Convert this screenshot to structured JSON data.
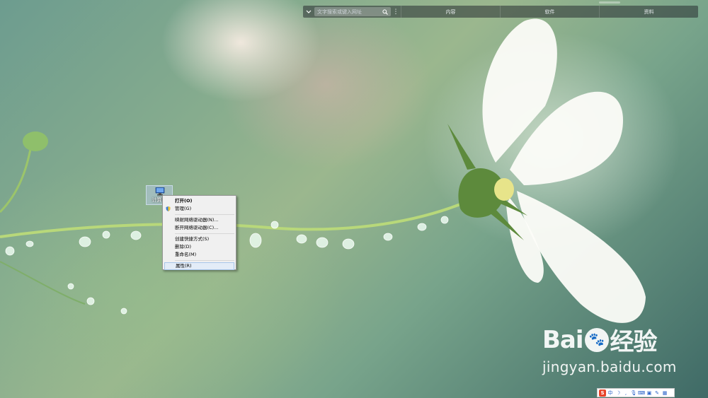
{
  "toolbar": {
    "search_placeholder": "文字搜索或键入网址",
    "tabs": [
      "内容",
      "软件",
      "资料"
    ]
  },
  "desktop_icon": {
    "label": "计算机"
  },
  "context_menu": {
    "items": [
      {
        "label": "打开(O)",
        "bold": true
      },
      {
        "label": "管理(G)",
        "icon": "shield-icon"
      },
      {
        "separator": true
      },
      {
        "label": "映射网络驱动器(N)..."
      },
      {
        "label": "断开网络驱动器(C)..."
      },
      {
        "separator": true
      },
      {
        "label": "创建快捷方式(S)"
      },
      {
        "label": "删除(D)"
      },
      {
        "label": "重命名(M)"
      },
      {
        "separator": true
      },
      {
        "label": "属性(R)",
        "highlighted": true
      }
    ]
  },
  "watermark": {
    "brand_left": "Bai",
    "brand_right": "经验",
    "url": "jingyan.baidu.com"
  },
  "tray": {
    "ime_logo": "S",
    "ime_mode": "中"
  },
  "colors": {
    "menu_bg": "#f0f0f0",
    "menu_highlight": "#e3ecf7",
    "ime_red": "#e8442a"
  }
}
